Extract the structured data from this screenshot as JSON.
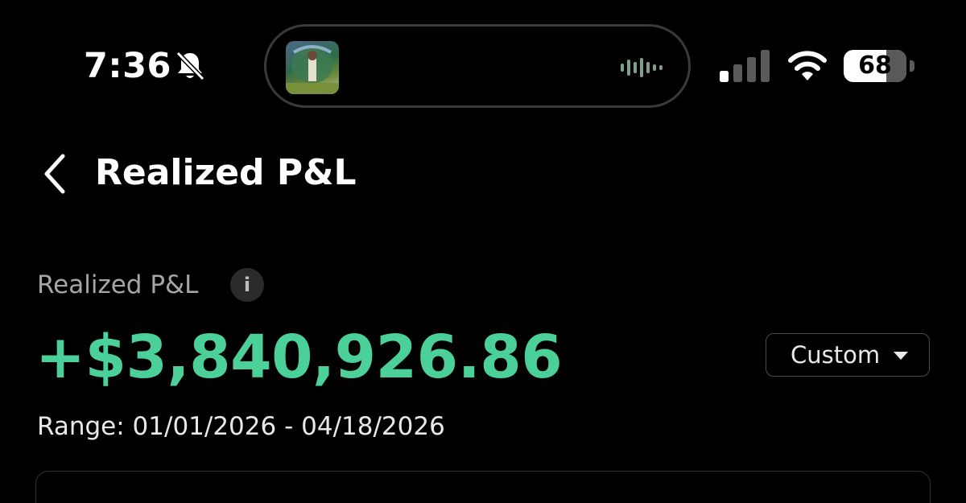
{
  "status_bar": {
    "time": "7:36",
    "battery_level": "68",
    "battery_fraction": 0.68,
    "silent_mode_icon": "bell-slash-icon",
    "signal_bars_filled": 1,
    "signal_bars_total": 4
  },
  "dynamic_island": {
    "album_art_icon": "album-art",
    "activity_icon": "audio-waveform-icon"
  },
  "header": {
    "back_icon": "chevron-left-icon",
    "title": "Realized P&L"
  },
  "summary": {
    "label": "Realized P&L",
    "info_icon_text": "i",
    "value": "+$3,840,926.86",
    "value_color": "#4cd09a",
    "range": "Range: 01/01/2026 - 04/18/2026"
  },
  "period_selector": {
    "selected": "Custom",
    "icon": "caret-down-icon"
  }
}
